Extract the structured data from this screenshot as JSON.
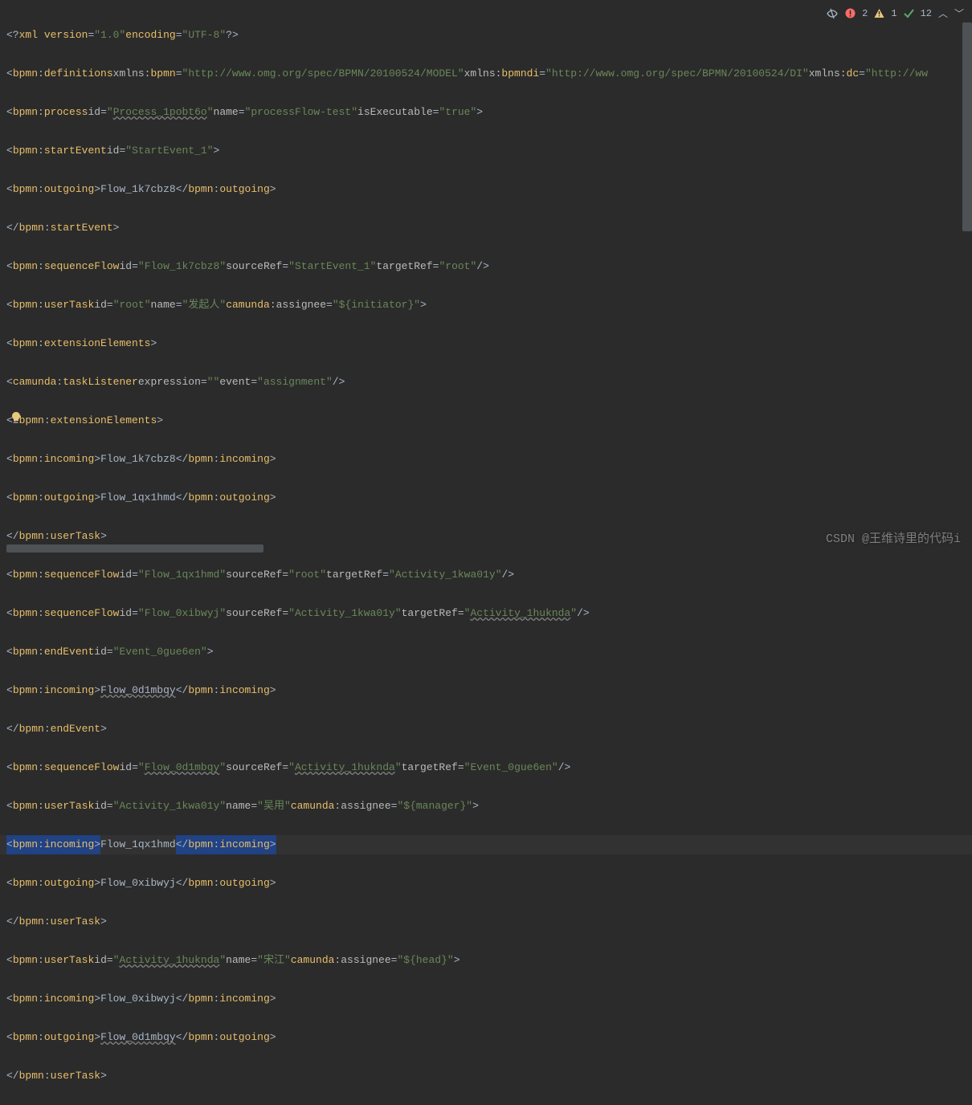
{
  "topbar": {
    "errors": "2",
    "warnings": "1",
    "checks": "12"
  },
  "watermark": "CSDN @王维诗里的代码i",
  "code": {
    "l1": {
      "xmlver": "1.0",
      "enc": "UTF-8"
    },
    "l2": {
      "ns": "bpmn",
      "tag": "definitions",
      "xmlns_pfx": "xmlns:",
      "bpmn": "bpmn",
      "bpmn_url": "http://www.omg.org/spec/BPMN/20100524/MODEL",
      "bpmndi": "bpmndi",
      "bpmndi_url": "http://www.omg.org/spec/BPMN/20100524/DI",
      "dc": "dc",
      "dc_url": "http://ww"
    },
    "l3": {
      "ns": "bpmn",
      "tag": "process",
      "id": "Process_1pobt6o",
      "name": "processFlow-test",
      "isExec": "true"
    },
    "l4": {
      "ns": "bpmn",
      "tag": "startEvent",
      "id": "StartEvent_1"
    },
    "l5": {
      "ns": "bpmn",
      "tag": "outgoing",
      "txt": "Flow_1k7cbz8"
    },
    "l6": {
      "ns": "bpmn",
      "tag": "startEvent"
    },
    "l7": {
      "ns": "bpmn",
      "tag": "sequenceFlow",
      "id": "Flow_1k7cbz8",
      "src": "StartEvent_1",
      "tgt": "root"
    },
    "l8": {
      "ns": "bpmn",
      "tag": "userTask",
      "id": "root",
      "name": "发起人",
      "cns": "camunda",
      "cattr": "assignee",
      "cval": "${initiator}"
    },
    "l9": {
      "ns": "bpmn",
      "tag": "extensionElements"
    },
    "l10": {
      "ns": "camunda",
      "tag": "taskListener",
      "expr": "",
      "evt": "assignment"
    },
    "l11": {
      "ns": "bpmn",
      "tag": "extensionElements"
    },
    "l12": {
      "ns": "bpmn",
      "tag": "incoming",
      "txt": "Flow_1k7cbz8"
    },
    "l13": {
      "ns": "bpmn",
      "tag": "outgoing",
      "txt": "Flow_1qx1hmd"
    },
    "l14": {
      "ns": "bpmn",
      "tag": "userTask"
    },
    "l15": {
      "ns": "bpmn",
      "tag": "sequenceFlow",
      "id": "Flow_1qx1hmd",
      "src": "root",
      "tgt": "Activity_1kwa01y"
    },
    "l16": {
      "ns": "bpmn",
      "tag": "sequenceFlow",
      "id": "Flow_0xibwyj",
      "src": "Activity_1kwa01y",
      "tgt": "Activity_1huknda"
    },
    "l17": {
      "ns": "bpmn",
      "tag": "endEvent",
      "id": "Event_0gue6en"
    },
    "l18": {
      "ns": "bpmn",
      "tag": "incoming",
      "txt": "Flow_0d1mbqy"
    },
    "l19": {
      "ns": "bpmn",
      "tag": "endEvent"
    },
    "l20": {
      "ns": "bpmn",
      "tag": "sequenceFlow",
      "id": "Flow_0d1mbqy",
      "src": "Activity_1huknda",
      "tgt": "Event_0gue6en"
    },
    "l21": {
      "ns": "bpmn",
      "tag": "userTask",
      "id": "Activity_1kwa01y",
      "name": "吴用",
      "cns": "camunda",
      "cattr": "assignee",
      "cval": "${manager}"
    },
    "l22": {
      "ns": "bpmn",
      "tag": "incoming",
      "txt": "Flow_1qx1hmd"
    },
    "l23": {
      "ns": "bpmn",
      "tag": "outgoing",
      "txt": "Flow_0xibwyj"
    },
    "l24": {
      "ns": "bpmn",
      "tag": "userTask"
    },
    "l25": {
      "ns": "bpmn",
      "tag": "userTask",
      "id": "Activity_1huknda",
      "name": "宋江",
      "cns": "camunda",
      "cattr": "assignee",
      "cval": "${head}"
    },
    "l26": {
      "ns": "bpmn",
      "tag": "incoming",
      "txt": "Flow_0xibwyj"
    },
    "l27": {
      "ns": "bpmn",
      "tag": "outgoing",
      "txt": "Flow_0d1mbqy"
    },
    "l28": {
      "ns": "bpmn",
      "tag": "userTask"
    }
  }
}
